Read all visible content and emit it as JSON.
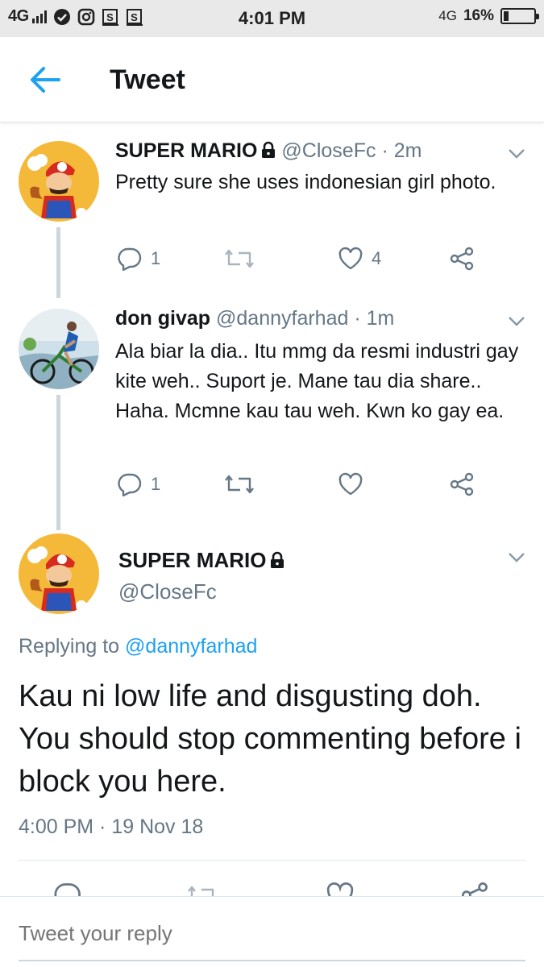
{
  "status_bar": {
    "network": "4G",
    "network_right": "4G",
    "time": "4:01 PM",
    "battery_percent": "16%",
    "battery_level": 0.16,
    "icons": [
      "signal-bars-icon",
      "check-circle-icon",
      "instagram-icon",
      "s-app-icon",
      "s-app-icon"
    ]
  },
  "header": {
    "title": "Tweet",
    "back_icon": "arrow-left-icon"
  },
  "colors": {
    "accent": "#1da1f2",
    "secondary_text": "#657786",
    "thread_line": "#ccd6dd"
  },
  "tweets": [
    {
      "name": "SUPER MARIO",
      "handle": "@CloseFc",
      "time": "· 2m",
      "text": "Pretty sure she uses indonesian girl photo.",
      "reply_count": "1",
      "retweet_count": "",
      "like_count": "4"
    },
    {
      "name": "don givap",
      "handle": "@dannyfarhad",
      "time": "· 1m",
      "text": "Ala biar la dia.. Itu mmg da resmi industri gay kite weh.. Suport je. Mane tau dia share.. Haha. Mcmne kau tau weh. Kwn ko gay ea.",
      "reply_count": "1",
      "retweet_count": "",
      "like_count": ""
    }
  ],
  "main_tweet": {
    "name": "SUPER MARIO",
    "handle": "@CloseFc",
    "replying_prefix": "Replying to",
    "replying_to": "@dannyfarhad",
    "text": "Kau ni low life and disgusting doh. You should stop commenting before i block you here.",
    "timestamp": "4:00 PM · 19 Nov 18"
  },
  "reply_box": {
    "placeholder": "Tweet your reply"
  }
}
